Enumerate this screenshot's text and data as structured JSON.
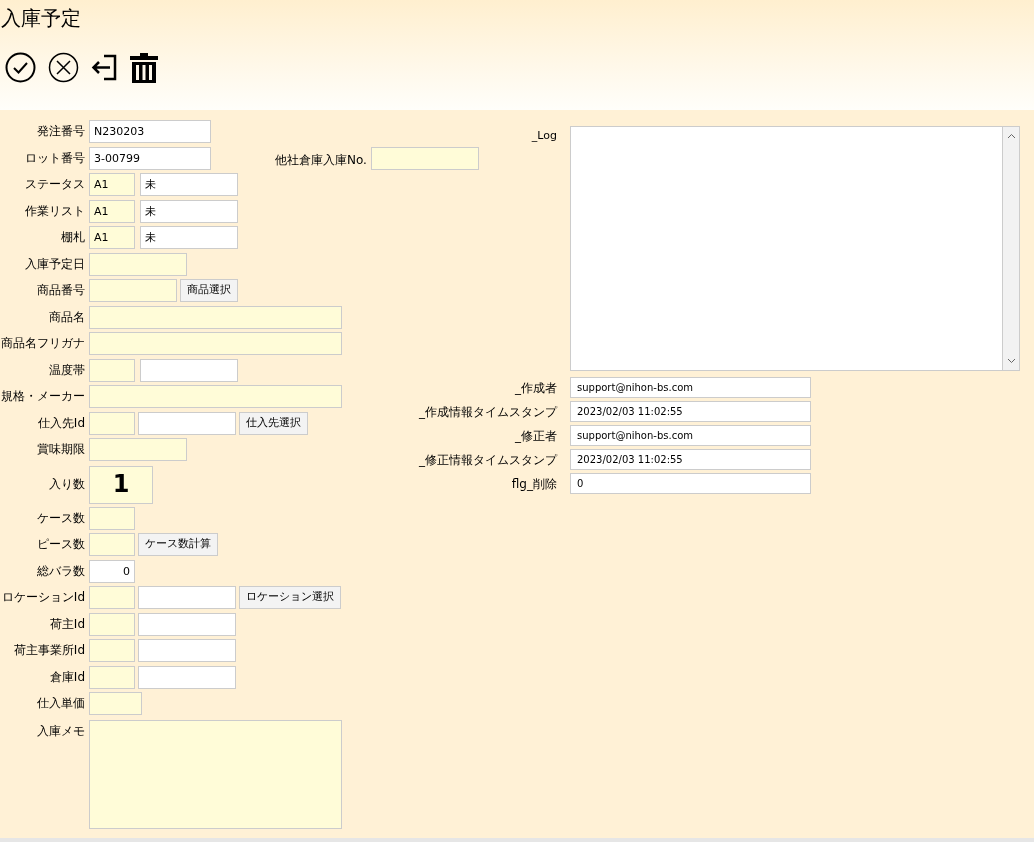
{
  "title": "入庫予定",
  "toolbar": [
    {
      "kind": "confirm"
    },
    {
      "kind": "cancel"
    },
    {
      "kind": "exit"
    },
    {
      "kind": "delete"
    }
  ],
  "form_rows": [
    {
      "label": "発注番号",
      "parts": [
        {
          "kind": "number",
          "value": "N230203"
        }
      ]
    },
    {
      "label": "ロット番号",
      "parts": [
        {
          "kind": "number",
          "value": "3-00799"
        },
        {
          "kind": "label",
          "text": "他社倉庫入庫No."
        },
        {
          "kind": "external"
        }
      ]
    },
    {
      "label": "ステータス",
      "parts": [
        {
          "kind": "code",
          "value": "A1"
        },
        {
          "kind": "name",
          "value": "未"
        }
      ]
    },
    {
      "label": "作業リスト",
      "parts": [
        {
          "kind": "code",
          "value": "A1"
        },
        {
          "kind": "name",
          "value": "未"
        }
      ]
    },
    {
      "label": "棚札",
      "parts": [
        {
          "kind": "code",
          "value": "A1"
        },
        {
          "kind": "name",
          "value": "未"
        }
      ]
    },
    {
      "label": "入庫予定日",
      "parts": [
        {
          "kind": "date"
        }
      ]
    },
    {
      "label": "商品番号",
      "parts": [
        {
          "kind": "product"
        },
        {
          "kind": "button",
          "text": "商品選択"
        }
      ]
    },
    {
      "label": "商品名",
      "parts": [
        {
          "kind": "wide"
        }
      ]
    },
    {
      "label": "商品名フリガナ",
      "parts": [
        {
          "kind": "wide"
        }
      ]
    },
    {
      "label": "温度帯",
      "parts": [
        {
          "kind": "code"
        },
        {
          "kind": "name"
        }
      ]
    },
    {
      "label": "規格・メーカー",
      "parts": [
        {
          "kind": "wide"
        }
      ]
    },
    {
      "label": "仕入先Id",
      "parts": [
        {
          "kind": "code"
        },
        {
          "kind": "idname"
        },
        {
          "kind": "button",
          "text": "仕入先選択"
        }
      ]
    },
    {
      "label": "賞味期限",
      "parts": [
        {
          "kind": "date"
        }
      ]
    },
    {
      "label": "入り数",
      "parts": [
        {
          "kind": "big",
          "value": "1"
        }
      ]
    },
    {
      "label": "ケース数",
      "parts": [
        {
          "kind": "code"
        }
      ]
    },
    {
      "label": "ピース数",
      "parts": [
        {
          "kind": "code"
        },
        {
          "kind": "button",
          "text": "ケース数計算"
        }
      ]
    },
    {
      "label": "総バラ数",
      "parts": [
        {
          "kind": "total",
          "value": "0"
        }
      ]
    },
    {
      "label": "ロケーションId",
      "parts": [
        {
          "kind": "code"
        },
        {
          "kind": "idname"
        },
        {
          "kind": "button",
          "text": "ロケーション選択"
        }
      ]
    },
    {
      "label": "荷主Id",
      "parts": [
        {
          "kind": "code"
        },
        {
          "kind": "idname"
        }
      ]
    },
    {
      "label": "荷主事業所Id",
      "parts": [
        {
          "kind": "code"
        },
        {
          "kind": "idname"
        }
      ]
    },
    {
      "label": "倉庫Id",
      "parts": [
        {
          "kind": "code"
        },
        {
          "kind": "idname"
        }
      ]
    },
    {
      "label": "仕入単価",
      "parts": [
        {
          "kind": "price"
        }
      ]
    },
    {
      "label": "入庫メモ",
      "parts": [
        {
          "kind": "memo"
        }
      ]
    }
  ],
  "log": {
    "label": "_Log"
  },
  "meta_rows": [
    {
      "label": "_作成者",
      "value": "support@nihon-bs.com"
    },
    {
      "label": "_作成情報タイムスタンプ",
      "value": "2023/02/03 11:02:55"
    },
    {
      "label": "_修正者",
      "value": "support@nihon-bs.com"
    },
    {
      "label": "_修正情報タイムスタンプ",
      "value": "2023/02/03 11:02:55"
    },
    {
      "label": "flg_削除",
      "value": "0"
    }
  ]
}
